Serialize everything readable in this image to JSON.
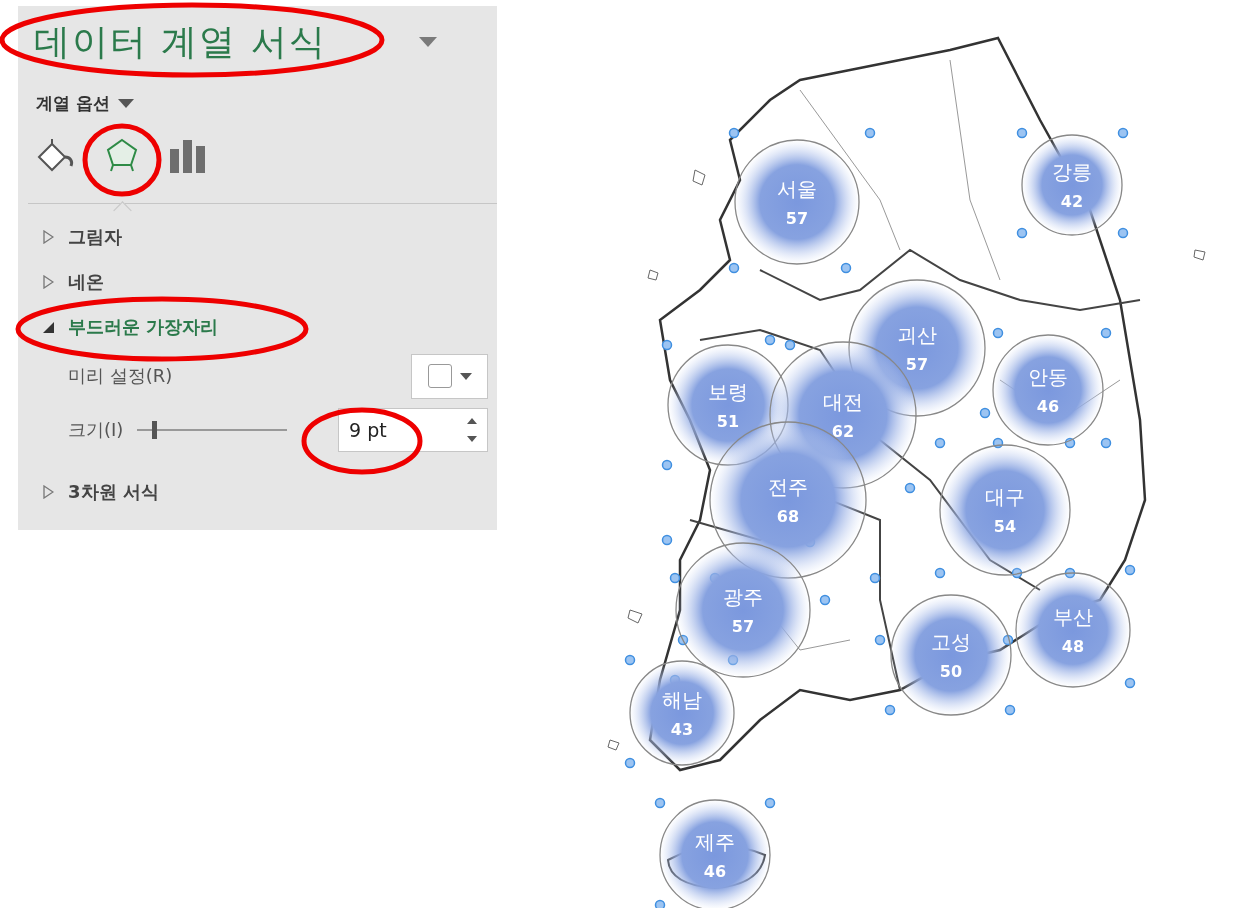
{
  "panel": {
    "title": "데이터 계열 서식",
    "options_label": "계열 옵션",
    "icon_tabs": [
      {
        "kind": "fill",
        "selected": false
      },
      {
        "kind": "effects",
        "selected": true
      },
      {
        "kind": "series",
        "selected": false
      }
    ],
    "sections": [
      {
        "label": "그림자",
        "expanded": false
      },
      {
        "label": "네온",
        "expanded": false
      },
      {
        "label": "부드러운 가장자리",
        "expanded": true,
        "fields": [
          {
            "kind": "preset",
            "label": "미리 설정(R)"
          },
          {
            "kind": "spin",
            "label": "크기(I)",
            "level": 0.1,
            "value": "9 pt"
          }
        ]
      },
      {
        "label": "3차원 서식",
        "expanded": false
      }
    ]
  },
  "map": {
    "bubbles": [
      {
        "name": "서울",
        "value": "57"
      },
      {
        "name": "강릉",
        "value": "42"
      },
      {
        "name": "괴산",
        "value": "57"
      },
      {
        "name": "안동",
        "value": "46"
      },
      {
        "name": "보령",
        "value": "51"
      },
      {
        "name": "대전",
        "value": "62"
      },
      {
        "name": "전주",
        "value": "68"
      },
      {
        "name": "대구",
        "value": "54"
      },
      {
        "name": "광주",
        "value": "57"
      },
      {
        "name": "부산",
        "value": "48"
      },
      {
        "name": "고성",
        "value": "50"
      },
      {
        "name": "해남",
        "value": "43"
      },
      {
        "name": "제주",
        "value": "46"
      }
    ]
  }
}
